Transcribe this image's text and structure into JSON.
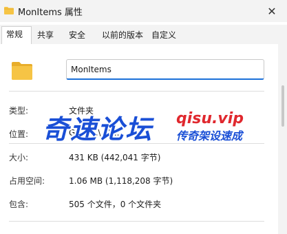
{
  "window": {
    "title": "MonItems 属性",
    "close_glyph": "✕",
    "title_icon": "folder-icon"
  },
  "tabs": [
    {
      "label": "常规",
      "active": true
    },
    {
      "label": "共享",
      "active": false
    },
    {
      "label": "安全",
      "active": false
    },
    {
      "label": "以前的版本",
      "active": false
    },
    {
      "label": "自定义",
      "active": false
    }
  ],
  "general": {
    "folder_icon": "folder-icon",
    "name_value": "MonItems",
    "type_label": "类型:",
    "type_value": "文件夹",
    "location_label": "位置:",
    "location_value": "G:\\Mi...\\...\\...",
    "size_label": "大小:",
    "size_value": "431 KB (442,041 字节)",
    "disk_size_label": "占用空间:",
    "disk_size_value": "1.06 MB (1,118,208 字节)",
    "contains_label": "包含:",
    "contains_value": "505 个文件，0 个文件夹"
  },
  "watermark": {
    "brand": "奇速论坛",
    "url": "qisu.vip",
    "slogan": "传奇架设速成"
  },
  "colors": {
    "folder_yellow": "#f6c445",
    "accent_blue": "#1a6fd8",
    "watermark_blue": "#1a4fd6",
    "watermark_red": "#e0282e"
  }
}
